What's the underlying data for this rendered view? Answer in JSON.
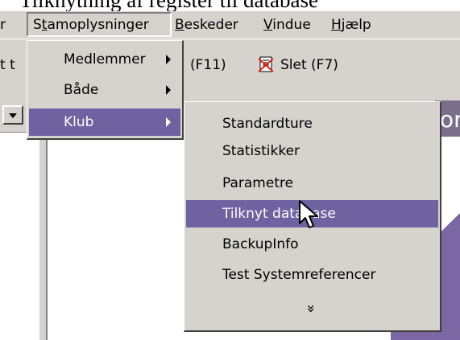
{
  "caption": "Tilknytning af register til database",
  "menubar": {
    "items": [
      {
        "label": "r"
      },
      {
        "label": "Stamoplysninger"
      },
      {
        "label": "Beskeder"
      },
      {
        "label": "Vindue"
      },
      {
        "label": "Hjælp"
      }
    ]
  },
  "toolbar": {
    "left_fragment": "t t",
    "shortcut_fragment": "(F11)",
    "delete_label": "Slet (F7)"
  },
  "header_fragment": "or",
  "stamoplysninger_menu": {
    "items": [
      {
        "label": "Medlemmer",
        "has_submenu": true
      },
      {
        "label": "Både",
        "has_submenu": true
      },
      {
        "label": "Klub",
        "has_submenu": true,
        "selected": true
      }
    ]
  },
  "klub_submenu": {
    "items": [
      {
        "label": "Standardture"
      },
      {
        "label": "Statistikker"
      },
      {
        "label": "Parametre"
      },
      {
        "label": "Tilknyt database",
        "selected": true
      },
      {
        "label": "BackupInfo"
      },
      {
        "label": "Test Systemreferencer"
      }
    ],
    "more_glyph": "»"
  },
  "colors": {
    "menu_bg": "#d6d3ce",
    "selection": "#6e62a0",
    "accent_purple": "#7b67a3"
  }
}
